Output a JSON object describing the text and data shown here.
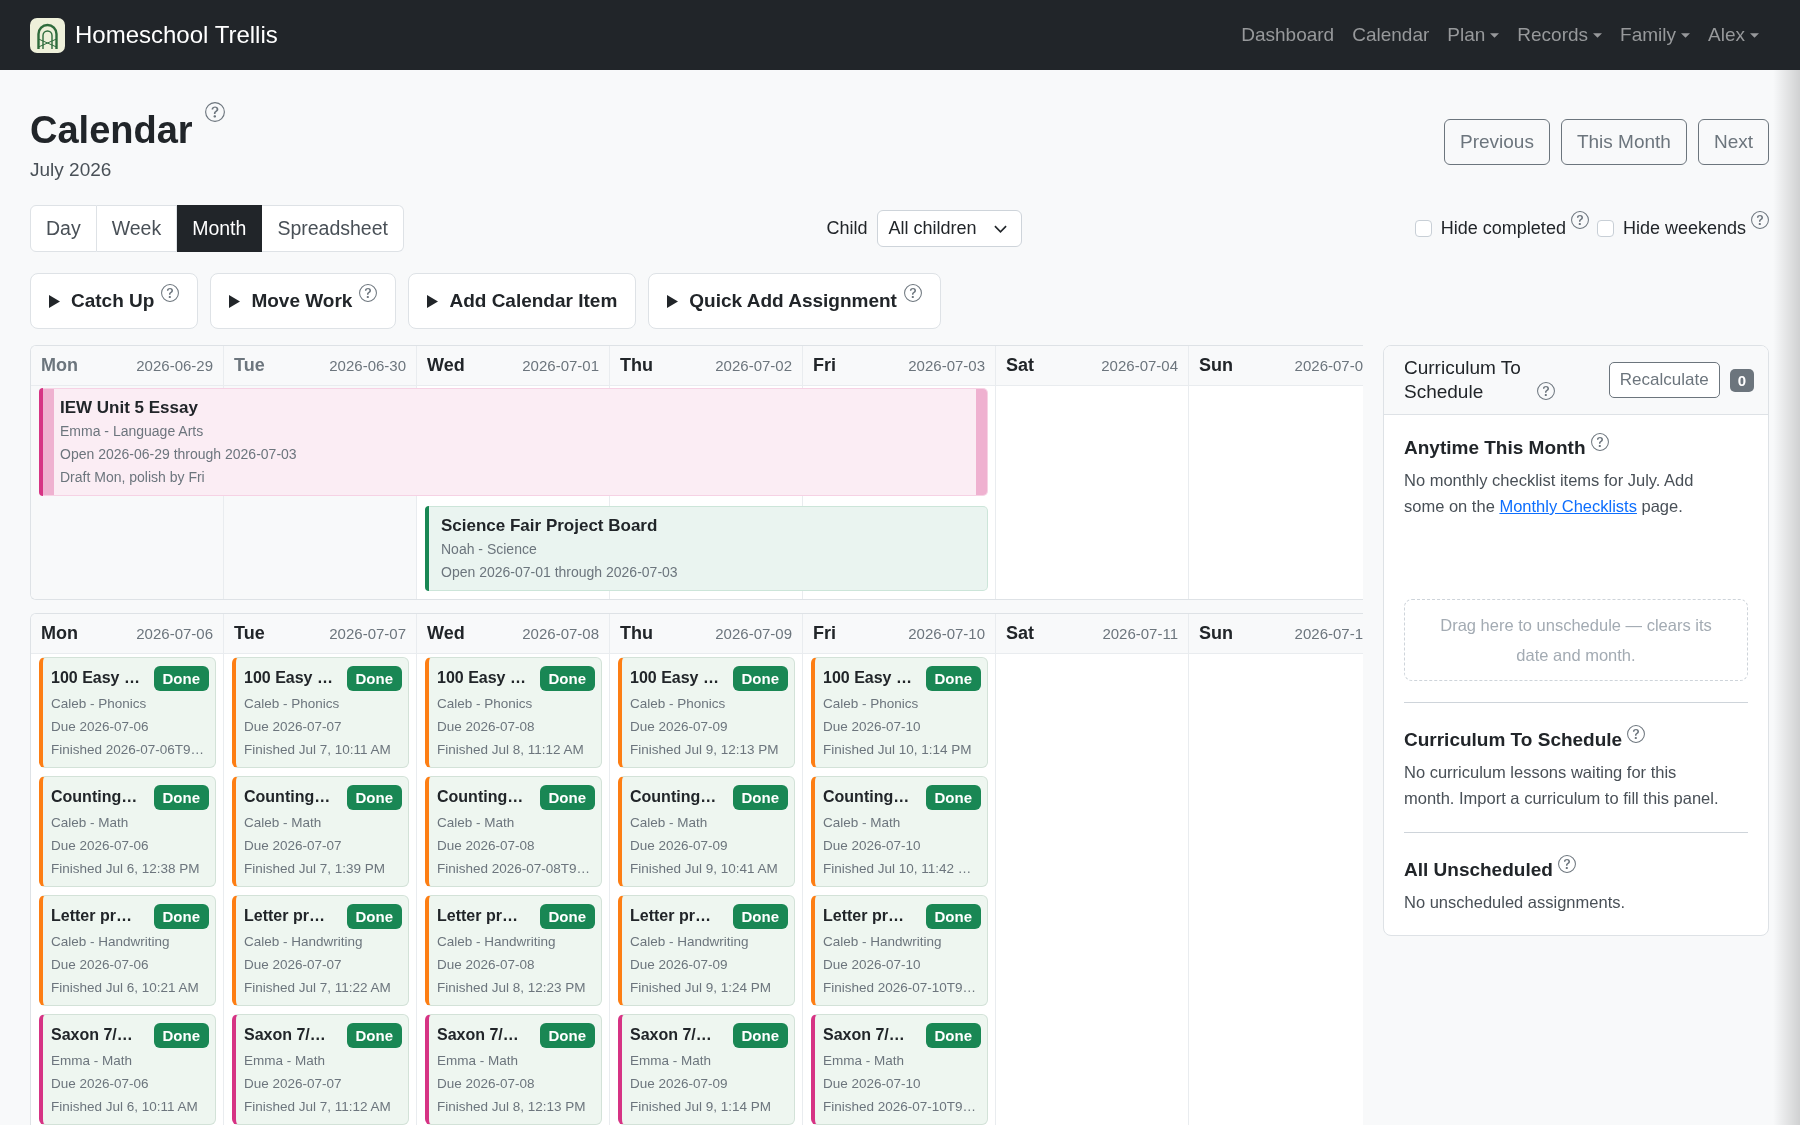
{
  "navbar": {
    "brand": "Homeschool Trellis",
    "links": [
      {
        "label": "Dashboard",
        "dropdown": false
      },
      {
        "label": "Calendar",
        "dropdown": false
      },
      {
        "label": "Plan",
        "dropdown": true
      },
      {
        "label": "Records",
        "dropdown": true
      },
      {
        "label": "Family",
        "dropdown": true
      },
      {
        "label": "Alex",
        "dropdown": true
      }
    ]
  },
  "header": {
    "title": "Calendar",
    "help": true,
    "subtitle": "July 2026",
    "buttons": [
      "Previous",
      "This Month",
      "Next"
    ]
  },
  "view_tabs": [
    {
      "label": "Day",
      "selected": false
    },
    {
      "label": "Week",
      "selected": false
    },
    {
      "label": "Month",
      "selected": true
    },
    {
      "label": "Spreadsheet",
      "selected": false
    }
  ],
  "child_filter": {
    "label": "Child",
    "value": "All children"
  },
  "toggles": [
    {
      "label": "Hide completed",
      "checked": false,
      "help": true
    },
    {
      "label": "Hide weekends",
      "checked": false,
      "help": true
    }
  ],
  "actions": [
    {
      "label": "Catch Up",
      "help": true
    },
    {
      "label": "Move Work",
      "help": true
    },
    {
      "label": "Add Calendar Item",
      "help": false
    },
    {
      "label": "Quick Add Assignment",
      "help": true
    }
  ],
  "calendar": {
    "weeks": [
      {
        "days": [
          {
            "name": "Mon",
            "date": "2026-06-29",
            "in_month": false
          },
          {
            "name": "Tue",
            "date": "2026-06-30",
            "in_month": false
          },
          {
            "name": "Wed",
            "date": "2026-07-01",
            "in_month": true
          },
          {
            "name": "Thu",
            "date": "2026-07-02",
            "in_month": true
          },
          {
            "name": "Fri",
            "date": "2026-07-03",
            "in_month": true
          },
          {
            "name": "Sat",
            "date": "2026-07-04",
            "in_month": true
          },
          {
            "name": "Sun",
            "date": "2026-07-0",
            "in_month": true
          }
        ],
        "spans": [
          {
            "title": "IEW Unit 5 Essay",
            "lines": [
              "Emma - Language Arts",
              "Open 2026-06-29 through 2026-07-03",
              "Draft Mon, polish by Fri"
            ],
            "color": "#d63384",
            "selected": true,
            "covers": [
              true,
              true,
              true,
              true,
              true,
              false,
              false
            ]
          },
          {
            "title": "Science Fair Project Board",
            "lines": [
              "Noah - Science",
              "Open 2026-07-01 through 2026-07-03"
            ],
            "color": "#198754",
            "selected": false,
            "covers": [
              false,
              false,
              true,
              true,
              true,
              false,
              false
            ]
          }
        ]
      },
      {
        "days": [
          {
            "name": "Mon",
            "date": "2026-07-06",
            "in_month": true,
            "items": [
              {
                "title": "100 Easy …",
                "badge": "Done",
                "done": true,
                "color": "#fd7e14",
                "lines": [
                  "Caleb - Phonics",
                  "Due 2026-07-06",
                  "Finished 2026-07-06T9…"
                ]
              },
              {
                "title": "Counting…",
                "badge": "Done",
                "done": true,
                "color": "#fd7e14",
                "lines": [
                  "Caleb - Math",
                  "Due 2026-07-06",
                  "Finished Jul 6, 12:38 PM"
                ]
              },
              {
                "title": "Letter pr…",
                "badge": "Done",
                "done": true,
                "color": "#fd7e14",
                "lines": [
                  "Caleb - Handwriting",
                  "Due 2026-07-06",
                  "Finished Jul 6, 10:21 AM"
                ]
              },
              {
                "title": "Saxon 7/…",
                "badge": "Done",
                "done": true,
                "color": "#d63384",
                "lines": [
                  "Emma - Math",
                  "Due 2026-07-06",
                  "Finished Jul 6, 10:11 AM"
                ]
              }
            ]
          },
          {
            "name": "Tue",
            "date": "2026-07-07",
            "in_month": true,
            "items": [
              {
                "title": "100 Easy …",
                "badge": "Done",
                "done": true,
                "color": "#fd7e14",
                "lines": [
                  "Caleb - Phonics",
                  "Due 2026-07-07",
                  "Finished Jul 7, 10:11 AM"
                ]
              },
              {
                "title": "Counting…",
                "badge": "Done",
                "done": true,
                "color": "#fd7e14",
                "lines": [
                  "Caleb - Math",
                  "Due 2026-07-07",
                  "Finished Jul 7, 1:39 PM"
                ]
              },
              {
                "title": "Letter pr…",
                "badge": "Done",
                "done": true,
                "color": "#fd7e14",
                "lines": [
                  "Caleb - Handwriting",
                  "Due 2026-07-07",
                  "Finished Jul 7, 11:22 AM"
                ]
              },
              {
                "title": "Saxon 7/…",
                "badge": "Done",
                "done": true,
                "color": "#d63384",
                "lines": [
                  "Emma - Math",
                  "Due 2026-07-07",
                  "Finished Jul 7, 11:12 AM"
                ]
              }
            ]
          },
          {
            "name": "Wed",
            "date": "2026-07-08",
            "in_month": true,
            "items": [
              {
                "title": "100 Easy …",
                "badge": "Done",
                "done": true,
                "color": "#fd7e14",
                "lines": [
                  "Caleb - Phonics",
                  "Due 2026-07-08",
                  "Finished Jul 8, 11:12 AM"
                ]
              },
              {
                "title": "Counting…",
                "badge": "Done",
                "done": true,
                "color": "#fd7e14",
                "lines": [
                  "Caleb - Math",
                  "Due 2026-07-08",
                  "Finished 2026-07-08T9…"
                ]
              },
              {
                "title": "Letter pr…",
                "badge": "Done",
                "done": true,
                "color": "#fd7e14",
                "lines": [
                  "Caleb - Handwriting",
                  "Due 2026-07-08",
                  "Finished Jul 8, 12:23 PM"
                ]
              },
              {
                "title": "Saxon 7/…",
                "badge": "Done",
                "done": true,
                "color": "#d63384",
                "lines": [
                  "Emma - Math",
                  "Due 2026-07-08",
                  "Finished Jul 8, 12:13 PM"
                ]
              }
            ]
          },
          {
            "name": "Thu",
            "date": "2026-07-09",
            "in_month": true,
            "items": [
              {
                "title": "100 Easy …",
                "badge": "Done",
                "done": true,
                "color": "#fd7e14",
                "lines": [
                  "Caleb - Phonics",
                  "Due 2026-07-09",
                  "Finished Jul 9, 12:13 PM"
                ]
              },
              {
                "title": "Counting…",
                "badge": "Done",
                "done": true,
                "color": "#fd7e14",
                "lines": [
                  "Caleb - Math",
                  "Due 2026-07-09",
                  "Finished Jul 9, 10:41 AM"
                ]
              },
              {
                "title": "Letter pr…",
                "badge": "Done",
                "done": true,
                "color": "#fd7e14",
                "lines": [
                  "Caleb - Handwriting",
                  "Due 2026-07-09",
                  "Finished Jul 9, 1:24 PM"
                ]
              },
              {
                "title": "Saxon 7/…",
                "badge": "Done",
                "done": true,
                "color": "#d63384",
                "lines": [
                  "Emma - Math",
                  "Due 2026-07-09",
                  "Finished Jul 9, 1:14 PM"
                ]
              }
            ]
          },
          {
            "name": "Fri",
            "date": "2026-07-10",
            "in_month": true,
            "items": [
              {
                "title": "100 Easy …",
                "badge": "Done",
                "done": true,
                "color": "#fd7e14",
                "lines": [
                  "Caleb - Phonics",
                  "Due 2026-07-10",
                  "Finished Jul 10, 1:14 PM"
                ]
              },
              {
                "title": "Counting…",
                "badge": "Done",
                "done": true,
                "color": "#fd7e14",
                "lines": [
                  "Caleb - Math",
                  "Due 2026-07-10",
                  "Finished Jul 10, 11:42 …"
                ]
              },
              {
                "title": "Letter pr…",
                "badge": "Done",
                "done": true,
                "color": "#fd7e14",
                "lines": [
                  "Caleb - Handwriting",
                  "Due 2026-07-10",
                  "Finished 2026-07-10T9…"
                ]
              },
              {
                "title": "Saxon 7/…",
                "badge": "Done",
                "done": true,
                "color": "#d63384",
                "lines": [
                  "Emma - Math",
                  "Due 2026-07-10",
                  "Finished 2026-07-10T9…"
                ]
              }
            ]
          },
          {
            "name": "Sat",
            "date": "2026-07-11",
            "in_month": true
          },
          {
            "name": "Sun",
            "date": "2026-07-1",
            "in_month": true
          }
        ]
      }
    ]
  },
  "sidebar": {
    "title": "Curriculum To Schedule",
    "help": true,
    "button": "Recalculate",
    "count": "0",
    "anytime": {
      "heading": "Anytime This Month",
      "help": true,
      "message_start": "No monthly checklist items for July. Add some on the",
      "link": "Monthly Checklists",
      "message_end": "page."
    },
    "dropzone": "Drag here to unschedule — clears its date and month.",
    "sections": [
      {
        "heading": "Curriculum To Schedule",
        "help": true,
        "message": "No curriculum lessons waiting for this month. Import a curriculum to fill this panel."
      },
      {
        "heading": "All Unscheduled",
        "help": true,
        "message": "No unscheduled assignments."
      }
    ]
  }
}
